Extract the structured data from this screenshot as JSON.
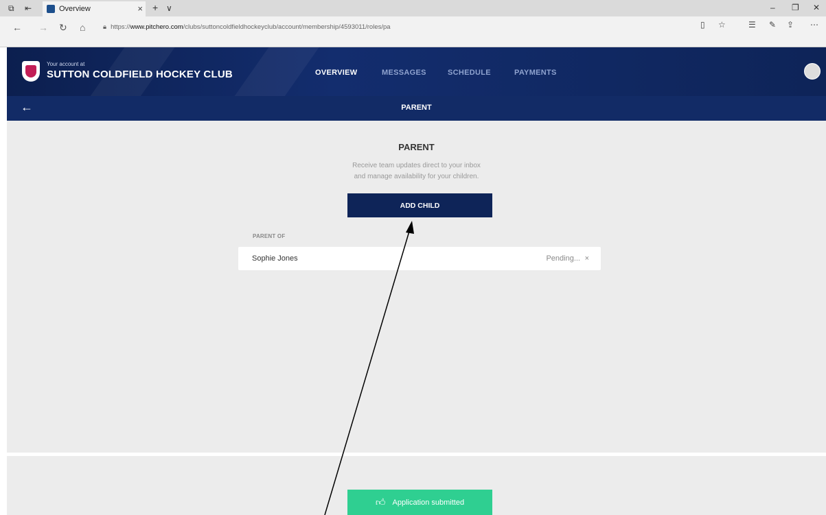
{
  "browser": {
    "tab_title": "Overview",
    "tab_close": "×",
    "new_tab": "+",
    "tab_menu": "∨",
    "url_prefix": "https://",
    "url_domain": "www.pitchero.com",
    "url_path": "/clubs/suttoncoldfieldhockeyclub/account/membership/4593011/roles/pa"
  },
  "header": {
    "account_label": "Your account at",
    "club_name": "SUTTON COLDFIELD HOCKEY CLUB",
    "nav": [
      "OVERVIEW",
      "MESSAGES",
      "SCHEDULE",
      "PAYMENTS"
    ],
    "active_nav": "OVERVIEW"
  },
  "subbar": {
    "title": "PARENT"
  },
  "main": {
    "heading": "PARENT",
    "description_line1": "Receive team updates direct to your inbox",
    "description_line2": "and manage availability for your children.",
    "add_child_label": "ADD CHILD",
    "parent_of_label": "PARENT OF",
    "children": [
      {
        "name": "Sophie Jones",
        "status": "Pending...",
        "remove": "×"
      }
    ]
  },
  "footer": {
    "toast_text": "Application submitted"
  },
  "colors": {
    "brand_navy": "#0e2458",
    "toast_green": "#2fcf91",
    "accent_crimson": "#c21e56"
  }
}
